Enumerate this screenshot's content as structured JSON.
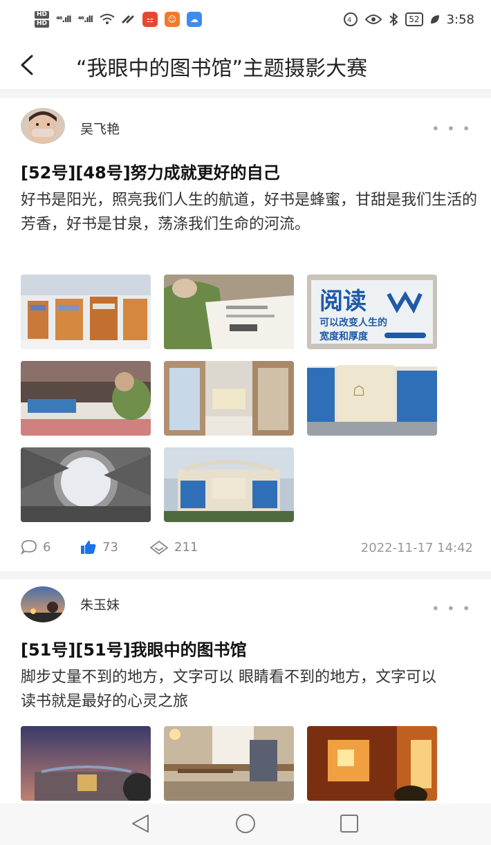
{
  "status_bar": {
    "hd1": "HD",
    "hd2": "HD",
    "sig1": "⁴⁶.ıll",
    "sig2": "⁴⁶.ıll",
    "battery": "52",
    "time": "3:58"
  },
  "header": {
    "title": "“我眼中的图书馆”主题摄影大赛"
  },
  "posts": [
    {
      "author": "吴飞艳",
      "title": "[52号][48号]努力成就更好的自己",
      "body": "好书是阳光，照亮我们人生的航道，好书是蜂蜜，甘甜是我们生活的芳香，好书是甘泉，荡涤我们生命的河流。",
      "comments": "6",
      "likes": "73",
      "views": "211",
      "timestamp": "2022-11-17 14:42",
      "thumbs": [
        "library-shelves",
        "reading-book",
        "reading-sign",
        "reader-at-desk",
        "bookshelf-aisle",
        "library-facade",
        "courtyard-sky",
        "library-building"
      ],
      "sign_text": {
        "line1": "阅读",
        "line2": "可以改变人生的",
        "line3": "宽度和厚度"
      }
    },
    {
      "author": "朱玉妹",
      "title": "[51号][51号]我眼中的图书馆",
      "body": "脚步丈量不到的地方，文字可以 眼睛看不到的地方，文字可以 读书就是最好的心灵之旅",
      "thumbs": [
        "library-dusk",
        "reading-room",
        "sunset-window"
      ]
    }
  ],
  "icons": {
    "back": "chevron-left-icon",
    "more": "more-dots-icon",
    "comment": "comment-icon",
    "like": "thumbs-up-icon",
    "view": "eye-icon"
  },
  "more_glyph": "• • •",
  "colors": {
    "like": "#1a73e8",
    "text_gray": "#888888"
  }
}
